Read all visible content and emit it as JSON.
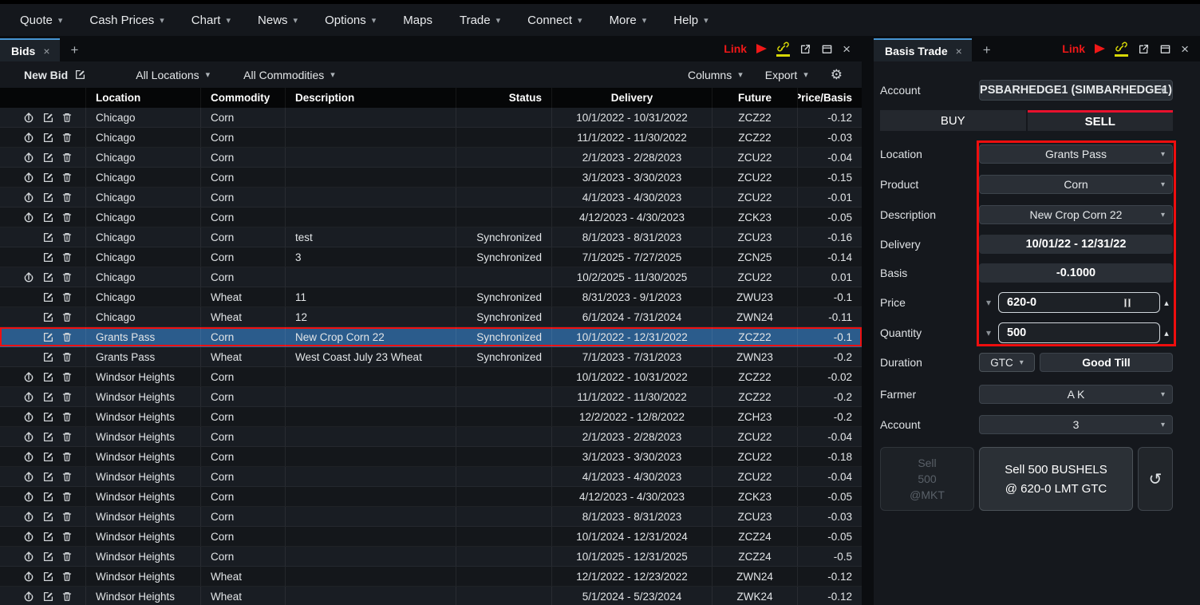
{
  "menu": {
    "items": [
      {
        "label": "Quote",
        "dropdown": true
      },
      {
        "label": "Cash Prices",
        "dropdown": true
      },
      {
        "label": "Chart",
        "dropdown": true
      },
      {
        "label": "News",
        "dropdown": true
      },
      {
        "label": "Options",
        "dropdown": true
      },
      {
        "label": "Maps",
        "dropdown": false
      },
      {
        "label": "Trade",
        "dropdown": true
      },
      {
        "label": "Connect",
        "dropdown": true
      },
      {
        "label": "More",
        "dropdown": true
      },
      {
        "label": "Help",
        "dropdown": true
      }
    ]
  },
  "link_cluster": {
    "label": "Link"
  },
  "left_panel": {
    "tab_label": "Bids",
    "toolbar": {
      "new_bid": "New Bid",
      "all_locations": "All Locations",
      "all_commodities": "All Commodities",
      "columns": "Columns",
      "export": "Export"
    },
    "table": {
      "columns": [
        "",
        "Location",
        "Commodity",
        "Description",
        "Status",
        "Delivery",
        "Future",
        "Price/Basis"
      ],
      "rows": [
        {
          "icons": [
            "upload",
            "edit",
            "delete"
          ],
          "location": "Chicago",
          "commodity": "Corn",
          "description": "",
          "status": "",
          "delivery": "10/1/2022 - 10/31/2022",
          "future": "ZCZ22",
          "price": "-0.12",
          "selected": false
        },
        {
          "icons": [
            "upload",
            "edit",
            "delete"
          ],
          "location": "Chicago",
          "commodity": "Corn",
          "description": "",
          "status": "",
          "delivery": "11/1/2022 - 11/30/2022",
          "future": "ZCZ22",
          "price": "-0.03",
          "selected": false
        },
        {
          "icons": [
            "upload",
            "edit",
            "delete"
          ],
          "location": "Chicago",
          "commodity": "Corn",
          "description": "",
          "status": "",
          "delivery": "2/1/2023 - 2/28/2023",
          "future": "ZCU22",
          "price": "-0.04",
          "selected": false
        },
        {
          "icons": [
            "upload",
            "edit",
            "delete"
          ],
          "location": "Chicago",
          "commodity": "Corn",
          "description": "",
          "status": "",
          "delivery": "3/1/2023 - 3/30/2023",
          "future": "ZCU22",
          "price": "-0.15",
          "selected": false
        },
        {
          "icons": [
            "upload",
            "edit",
            "delete"
          ],
          "location": "Chicago",
          "commodity": "Corn",
          "description": "",
          "status": "",
          "delivery": "4/1/2023 - 4/30/2023",
          "future": "ZCU22",
          "price": "-0.01",
          "selected": false
        },
        {
          "icons": [
            "upload",
            "edit",
            "delete"
          ],
          "location": "Chicago",
          "commodity": "Corn",
          "description": "",
          "status": "",
          "delivery": "4/12/2023 - 4/30/2023",
          "future": "ZCK23",
          "price": "-0.05",
          "selected": false
        },
        {
          "icons": [
            "edit",
            "delete"
          ],
          "location": "Chicago",
          "commodity": "Corn",
          "description": "test",
          "status": "Synchronized",
          "delivery": "8/1/2023 - 8/31/2023",
          "future": "ZCU23",
          "price": "-0.16",
          "selected": false
        },
        {
          "icons": [
            "edit",
            "delete"
          ],
          "location": "Chicago",
          "commodity": "Corn",
          "description": "3",
          "status": "Synchronized",
          "delivery": "7/1/2025 - 7/27/2025",
          "future": "ZCN25",
          "price": "-0.14",
          "selected": false
        },
        {
          "icons": [
            "upload",
            "edit",
            "delete"
          ],
          "location": "Chicago",
          "commodity": "Corn",
          "description": "",
          "status": "",
          "delivery": "10/2/2025 - 11/30/2025",
          "future": "ZCU22",
          "price": "0.01",
          "selected": false
        },
        {
          "icons": [
            "edit",
            "delete"
          ],
          "location": "Chicago",
          "commodity": "Wheat",
          "description": "11",
          "status": "Synchronized",
          "delivery": "8/31/2023 - 9/1/2023",
          "future": "ZWU23",
          "price": "-0.1",
          "selected": false
        },
        {
          "icons": [
            "edit",
            "delete"
          ],
          "location": "Chicago",
          "commodity": "Wheat",
          "description": "12",
          "status": "Synchronized",
          "delivery": "6/1/2024 - 7/31/2024",
          "future": "ZWN24",
          "price": "-0.11",
          "selected": false
        },
        {
          "icons": [
            "edit",
            "delete"
          ],
          "location": "Grants Pass",
          "commodity": "Corn",
          "description": "New Crop Corn 22",
          "status": "Synchronized",
          "delivery": "10/1/2022 - 12/31/2022",
          "future": "ZCZ22",
          "price": "-0.1",
          "selected": true
        },
        {
          "icons": [
            "edit",
            "delete"
          ],
          "location": "Grants Pass",
          "commodity": "Wheat",
          "description": "West Coast July 23 Wheat",
          "status": "Synchronized",
          "delivery": "7/1/2023 - 7/31/2023",
          "future": "ZWN23",
          "price": "-0.2",
          "selected": false
        },
        {
          "icons": [
            "upload",
            "edit",
            "delete"
          ],
          "location": "Windsor Heights",
          "commodity": "Corn",
          "description": "",
          "status": "",
          "delivery": "10/1/2022 - 10/31/2022",
          "future": "ZCZ22",
          "price": "-0.02",
          "selected": false
        },
        {
          "icons": [
            "upload",
            "edit",
            "delete"
          ],
          "location": "Windsor Heights",
          "commodity": "Corn",
          "description": "",
          "status": "",
          "delivery": "11/1/2022 - 11/30/2022",
          "future": "ZCZ22",
          "price": "-0.2",
          "selected": false
        },
        {
          "icons": [
            "upload",
            "edit",
            "delete"
          ],
          "location": "Windsor Heights",
          "commodity": "Corn",
          "description": "",
          "status": "",
          "delivery": "12/2/2022 - 12/8/2022",
          "future": "ZCH23",
          "price": "-0.2",
          "selected": false
        },
        {
          "icons": [
            "upload",
            "edit",
            "delete"
          ],
          "location": "Windsor Heights",
          "commodity": "Corn",
          "description": "",
          "status": "",
          "delivery": "2/1/2023 - 2/28/2023",
          "future": "ZCU22",
          "price": "-0.04",
          "selected": false
        },
        {
          "icons": [
            "upload",
            "edit",
            "delete"
          ],
          "location": "Windsor Heights",
          "commodity": "Corn",
          "description": "",
          "status": "",
          "delivery": "3/1/2023 - 3/30/2023",
          "future": "ZCU22",
          "price": "-0.18",
          "selected": false
        },
        {
          "icons": [
            "upload",
            "edit",
            "delete"
          ],
          "location": "Windsor Heights",
          "commodity": "Corn",
          "description": "",
          "status": "",
          "delivery": "4/1/2023 - 4/30/2023",
          "future": "ZCU22",
          "price": "-0.04",
          "selected": false
        },
        {
          "icons": [
            "upload",
            "edit",
            "delete"
          ],
          "location": "Windsor Heights",
          "commodity": "Corn",
          "description": "",
          "status": "",
          "delivery": "4/12/2023 - 4/30/2023",
          "future": "ZCK23",
          "price": "-0.05",
          "selected": false
        },
        {
          "icons": [
            "upload",
            "edit",
            "delete"
          ],
          "location": "Windsor Heights",
          "commodity": "Corn",
          "description": "",
          "status": "",
          "delivery": "8/1/2023 - 8/31/2023",
          "future": "ZCU23",
          "price": "-0.03",
          "selected": false
        },
        {
          "icons": [
            "upload",
            "edit",
            "delete"
          ],
          "location": "Windsor Heights",
          "commodity": "Corn",
          "description": "",
          "status": "",
          "delivery": "10/1/2024 - 12/31/2024",
          "future": "ZCZ24",
          "price": "-0.05",
          "selected": false
        },
        {
          "icons": [
            "upload",
            "edit",
            "delete"
          ],
          "location": "Windsor Heights",
          "commodity": "Corn",
          "description": "",
          "status": "",
          "delivery": "10/1/2025 - 12/31/2025",
          "future": "ZCZ24",
          "price": "-0.5",
          "selected": false
        },
        {
          "icons": [
            "upload",
            "edit",
            "delete"
          ],
          "location": "Windsor Heights",
          "commodity": "Wheat",
          "description": "",
          "status": "",
          "delivery": "12/1/2022 - 12/23/2022",
          "future": "ZWN24",
          "price": "-0.12",
          "selected": false
        },
        {
          "icons": [
            "upload",
            "edit",
            "delete"
          ],
          "location": "Windsor Heights",
          "commodity": "Wheat",
          "description": "",
          "status": "",
          "delivery": "5/1/2024 - 5/23/2024",
          "future": "ZWK24",
          "price": "-0.12",
          "selected": false
        }
      ]
    }
  },
  "right_panel": {
    "tab_label": "Basis Trade",
    "account": {
      "label": "Account",
      "value": "PSBARHEDGE1 (SIMBARHEDGE1)"
    },
    "buy_label": "BUY",
    "sell_label": "SELL",
    "side_selected": "SELL",
    "fields": {
      "location": {
        "label": "Location",
        "value": "Grants Pass"
      },
      "product": {
        "label": "Product",
        "value": "Corn"
      },
      "description": {
        "label": "Description",
        "value": "New Crop Corn 22"
      },
      "delivery": {
        "label": "Delivery",
        "value": "10/01/22  -  12/31/22"
      },
      "basis": {
        "label": "Basis",
        "value": "-0.1000"
      },
      "price": {
        "label": "Price",
        "value": "620-0"
      },
      "quantity": {
        "label": "Quantity",
        "value": "500"
      }
    },
    "duration": {
      "label": "Duration",
      "value": "GTC",
      "good_till": "Good Till"
    },
    "farmer": {
      "label": "Farmer",
      "value": "A K"
    },
    "account2": {
      "label": "Account",
      "value": "3"
    },
    "market_button": {
      "line1": "Sell",
      "line2": "500",
      "line3": "@MKT"
    },
    "limit_button": {
      "line1": "Sell 500 BUSHELS",
      "line2": "@ 620-0 LMT GTC"
    },
    "reset_icon": "↺"
  },
  "icons": {
    "tab_close": "×",
    "tab_add": "+",
    "caret_down": "▾",
    "caret_up": "▴",
    "gear": "⚙"
  },
  "colors": {
    "accent_red": "#ee1010",
    "link_red": "#f01818",
    "link_yellow": "#d8d806",
    "tab_blue": "#4695d2",
    "selected_row_blue": "#2b5c8c",
    "sell_underline_red": "#e8112d"
  }
}
